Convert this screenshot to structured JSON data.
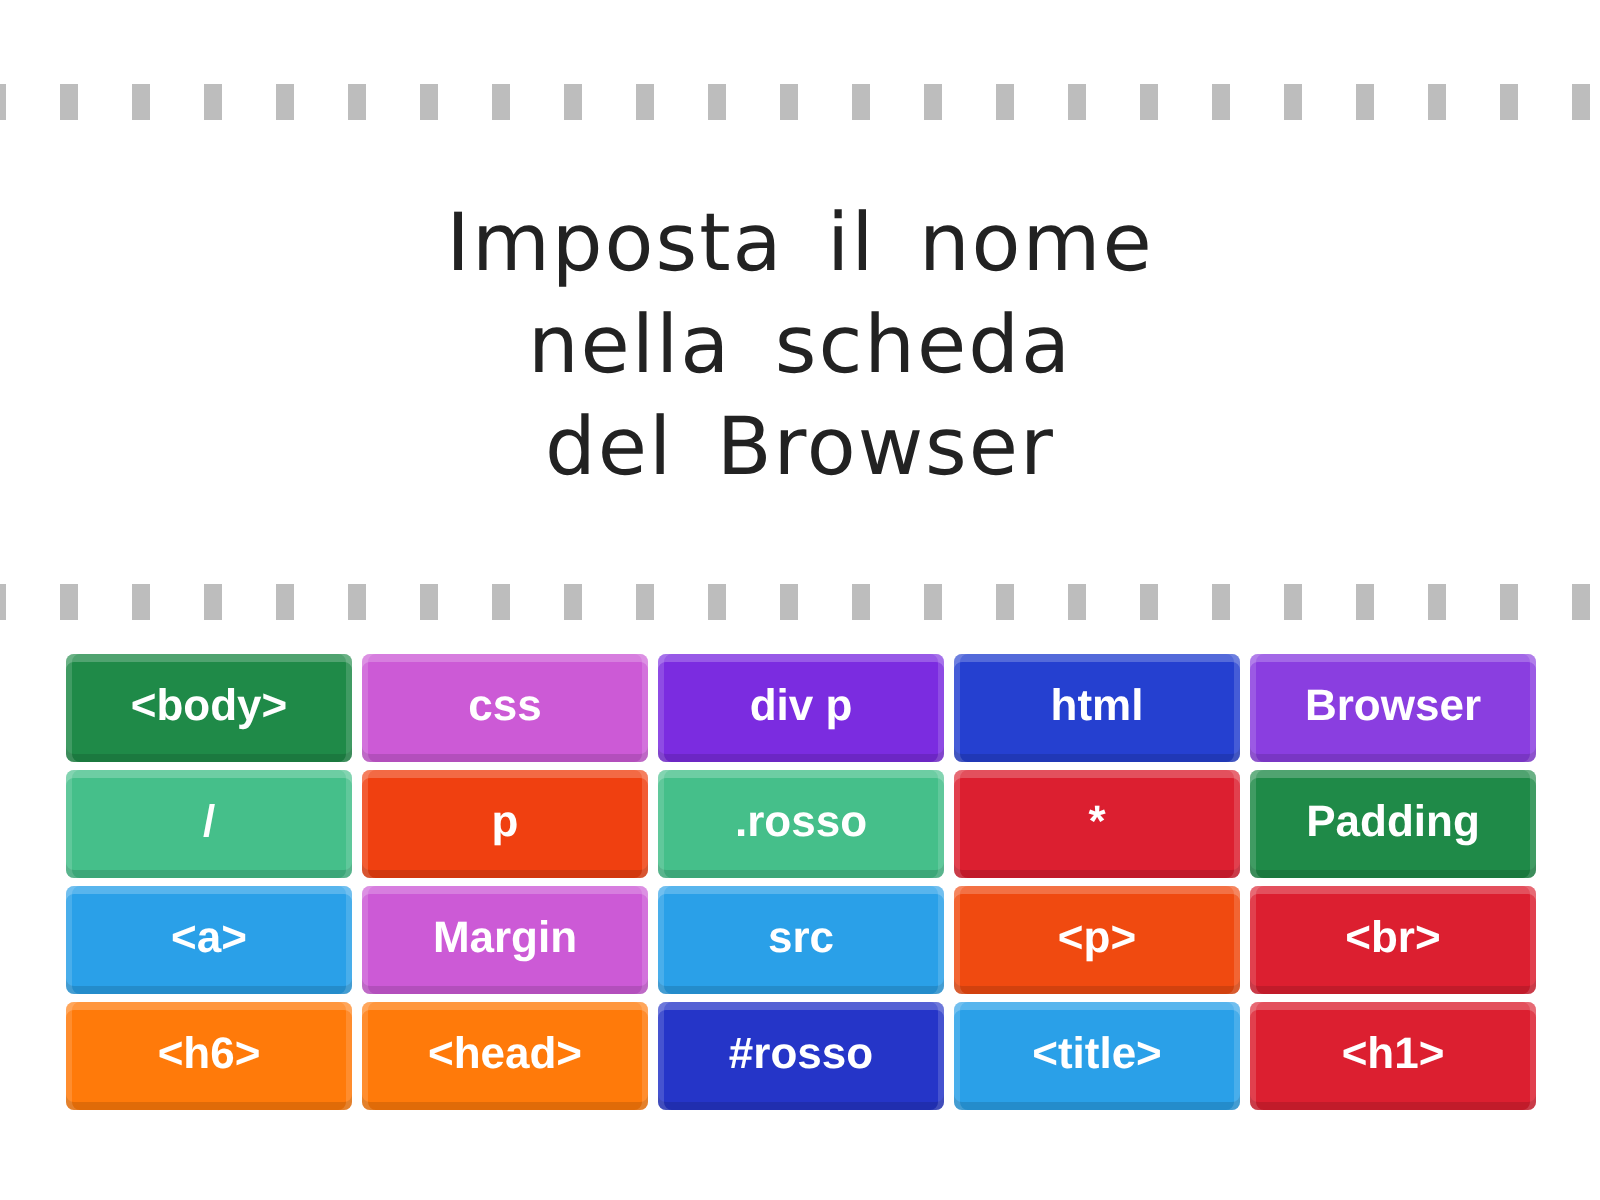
{
  "question": {
    "text": "Imposta il nome\nnella scheda\ndel Browser"
  },
  "tiles": [
    {
      "label": "<body>",
      "color": "#1f8a48"
    },
    {
      "label": "css",
      "color": "#cc5ad6"
    },
    {
      "label": "div p",
      "color": "#7b2ce0"
    },
    {
      "label": "html",
      "color": "#2540d0"
    },
    {
      "label": "Browser",
      "color": "#8a3ee0"
    },
    {
      "label": "/",
      "color": "#45bf8a"
    },
    {
      "label": "p",
      "color": "#f04010"
    },
    {
      "label": ".rosso",
      "color": "#45bf8a"
    },
    {
      "label": "*",
      "color": "#dc1f30"
    },
    {
      "label": "Padding",
      "color": "#1f8a48"
    },
    {
      "label": "<a>",
      "color": "#2aa0e8"
    },
    {
      "label": "Margin",
      "color": "#cc5ad6"
    },
    {
      "label": "src",
      "color": "#2aa0e8"
    },
    {
      "label": "<p>",
      "color": "#f04a10"
    },
    {
      "label": "<br>",
      "color": "#dc1f30"
    },
    {
      "label": "<h6>",
      "color": "#ff7a0a"
    },
    {
      "label": "<head>",
      "color": "#ff7a0a"
    },
    {
      "label": "#rosso",
      "color": "#2535c8"
    },
    {
      "label": "<title>",
      "color": "#2aa0e8"
    },
    {
      "label": "<h1>",
      "color": "#dc1f30"
    }
  ]
}
